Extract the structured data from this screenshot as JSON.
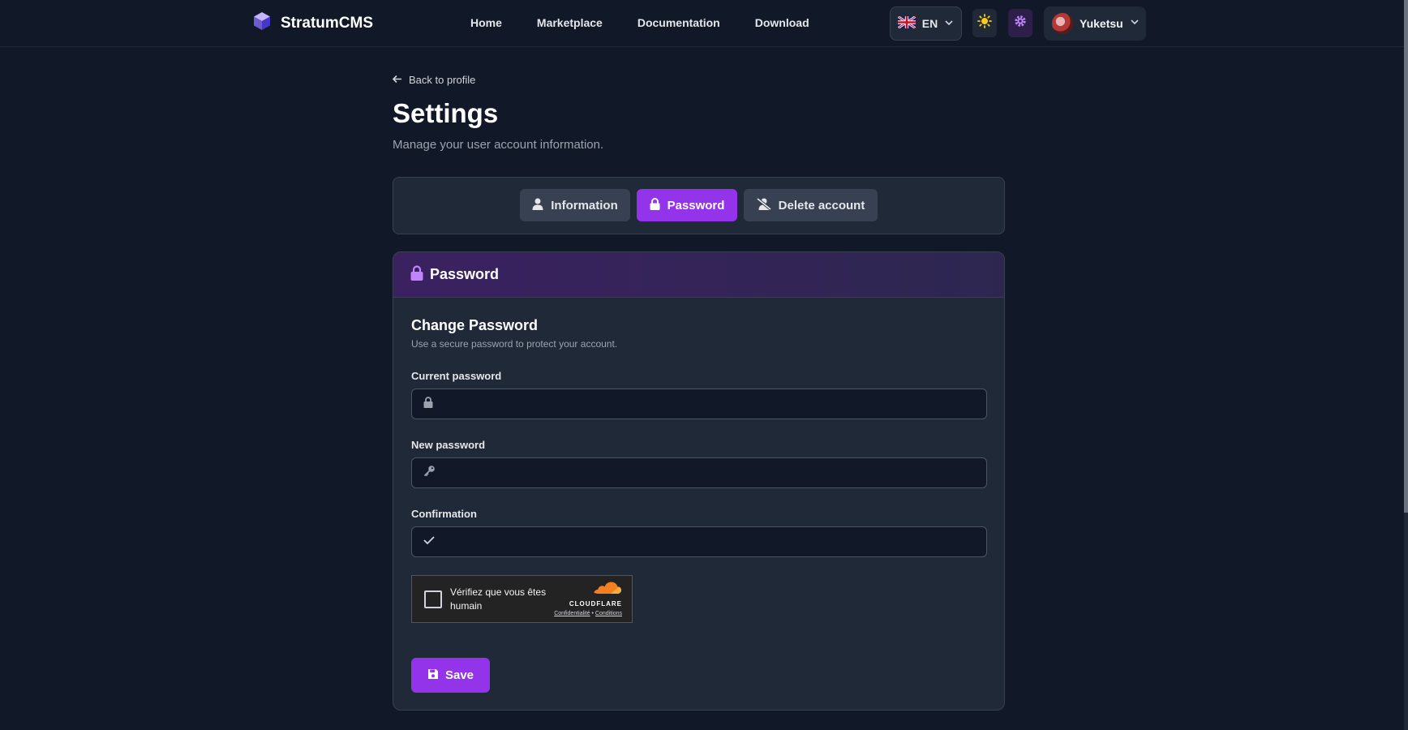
{
  "app": {
    "brand": "StratumCMS"
  },
  "nav": {
    "items": [
      "Home",
      "Marketplace",
      "Documentation",
      "Download"
    ]
  },
  "header": {
    "language": "EN",
    "user_name": "Yuketsu"
  },
  "page": {
    "back_label": "Back to profile",
    "title": "Settings",
    "subtitle": "Manage your user account information."
  },
  "tabs": [
    {
      "label": "Information",
      "icon": "user-icon",
      "active": false
    },
    {
      "label": "Password",
      "icon": "lock-icon",
      "active": true
    },
    {
      "label": "Delete account",
      "icon": "user-delete-icon",
      "active": false
    }
  ],
  "card": {
    "header_title": "Password",
    "section_title": "Change Password",
    "section_subtitle": "Use a secure password to protect your account.",
    "fields": {
      "current": {
        "label": "Current password",
        "value": "",
        "icon": "lock-icon"
      },
      "new": {
        "label": "New password",
        "value": "",
        "icon": "key-icon"
      },
      "confirm": {
        "label": "Confirmation",
        "value": "",
        "icon": "check-icon"
      }
    },
    "captcha": {
      "text": "Vérifiez que vous êtes humain",
      "brand": "CLOUDFLARE",
      "privacy": "Confidentialité",
      "separator": "•",
      "terms": "Conditions"
    },
    "save_label": "Save"
  },
  "colors": {
    "background": "#111827",
    "card": "#1f2937",
    "accent": "#9333ea",
    "cloudflare_orange": "#f38020"
  }
}
